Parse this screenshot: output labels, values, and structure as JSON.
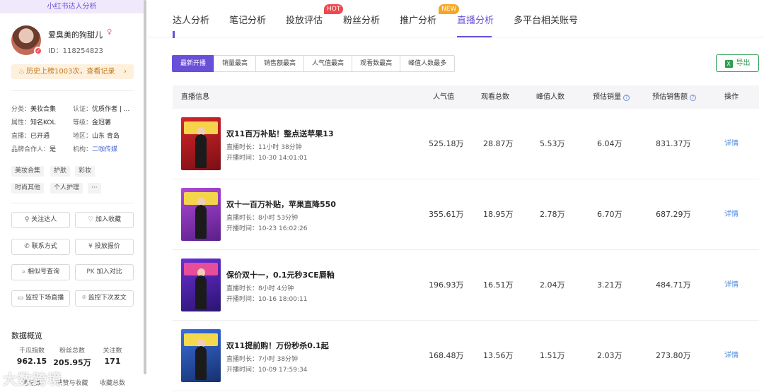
{
  "brand": {
    "title": "小红书达人分析"
  },
  "profile": {
    "name": "爱臭美的狗甜儿",
    "id_text": "ID：118254823",
    "history_text": "历史上榜1003次，查看记录",
    "info": {
      "category": {
        "label": "分类：",
        "value": "美妆合集"
      },
      "cert": {
        "label": "认证：",
        "value": "优质作者 | ..."
      },
      "attr": {
        "label": "属性：",
        "value": "知名KOL"
      },
      "level": {
        "label": "等级：",
        "value": "金冠薯"
      },
      "live": {
        "label": "直播：",
        "value": "已开通"
      },
      "region": {
        "label": "地区：",
        "value": "山东 青岛"
      },
      "brand_partner": {
        "label": "品牌合作人：",
        "value": "是"
      },
      "agency": {
        "label": "机构：",
        "value": "二咖传媒"
      }
    },
    "tags": [
      "美妆合集",
      "护肤",
      "彩妆",
      "时尚其他",
      "个人护理",
      "···"
    ],
    "buttons": {
      "follow": "关注达人",
      "favorite": "加入收藏",
      "contact": "联系方式",
      "quote": "投放报价",
      "similar": "相似号查询",
      "compare": "加入对比",
      "pk_icon": "PK",
      "monitor_live": "监控下场直播",
      "monitor_post": "监控下次发文"
    },
    "stats_title": "数据概览",
    "stats": [
      {
        "label": "千瓜指数",
        "value": "962.15"
      },
      {
        "label": "粉丝总数",
        "value": "205.95万"
      },
      {
        "label": "关注数",
        "value": "171"
      }
    ],
    "stats2": [
      {
        "label": "笔记数"
      },
      {
        "label": "获赞与收藏"
      },
      {
        "label": "收藏总数"
      }
    ]
  },
  "nav": {
    "tabs": [
      "达人分析",
      "笔记分析",
      "投放评估",
      "粉丝分析",
      "推广分析",
      "直播分析",
      "多平台相关账号"
    ],
    "active": "直播分析",
    "badge_hot": "HOT",
    "badge_new": "NEW"
  },
  "filters": [
    "最新开播",
    "销量最高",
    "销售额最高",
    "人气值最高",
    "观看数最高",
    "峰值人数最多"
  ],
  "export_label": "导出",
  "table": {
    "headers": [
      "直播信息",
      "人气值",
      "观看总数",
      "峰值人数",
      "预估销量",
      "预估销售额",
      "操作"
    ],
    "rows": [
      {
        "title": "双11百万补贴！整点送苹果13",
        "duration": "直播时长：11小时 38分钟",
        "start": "开播时间：10-30 14:01:01",
        "popularity": "525.18万",
        "views": "28.87万",
        "peak": "5.53万",
        "sales": "6.04万",
        "revenue": "831.37万",
        "action": "详情"
      },
      {
        "title": "双十一百万补贴，苹果直降550",
        "duration": "直播时长：8小时 53分钟",
        "start": "开播时间：10-23 16:02:26",
        "popularity": "355.61万",
        "views": "18.95万",
        "peak": "2.78万",
        "sales": "6.70万",
        "revenue": "687.29万",
        "action": "详情"
      },
      {
        "title": "保价双十一，0.1元秒3CE唇釉",
        "duration": "直播时长：8小时 4分钟",
        "start": "开播时间：10-16 18:00:11",
        "popularity": "196.93万",
        "views": "16.51万",
        "peak": "2.04万",
        "sales": "3.21万",
        "revenue": "484.71万",
        "action": "详情"
      },
      {
        "title": "双11提前购！万份秒杀0.1起",
        "duration": "直播时长：7小时 38分钟",
        "start": "开播时间：10-09 17:59:34",
        "popularity": "168.48万",
        "views": "13.56万",
        "peak": "1.51万",
        "sales": "2.03万",
        "revenue": "273.80万",
        "action": "详情"
      }
    ]
  },
  "watermark": "大数跨境",
  "colors": {
    "accent": "#6a4fd8",
    "link": "#4a8ae0",
    "export": "#2e9e4f",
    "hot": "#f0484e",
    "new": "#f5a623"
  }
}
